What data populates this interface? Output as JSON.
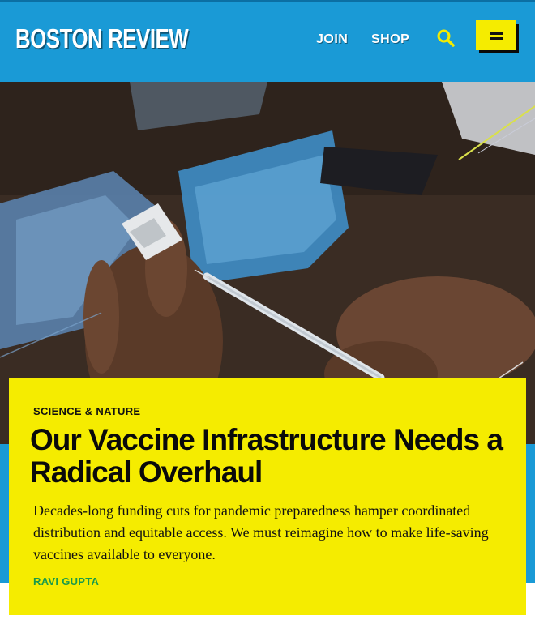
{
  "header": {
    "logo": "BOSTON REVIEW",
    "nav": {
      "join": "JOIN",
      "shop": "SHOP"
    },
    "search_icon": "search-icon",
    "menu_icon": "hamburger-menu-icon"
  },
  "hero": {
    "image_icon": "vaccine-syringe-photo"
  },
  "article": {
    "category": "SCIENCE & NATURE",
    "title": "Our Vaccine Infrastructure Needs a Radical Overhaul",
    "dek": "Decades-long funding cuts for pandemic preparedness hamper coordinated distribution and equitable access. We must reimagine how to make life-saving vaccines available to everyone.",
    "author": "RAVI GUPTA"
  },
  "colors": {
    "brand_blue": "#1a9ad6",
    "accent_yellow": "#f5ec00",
    "byline_green": "#1a9a4a"
  }
}
